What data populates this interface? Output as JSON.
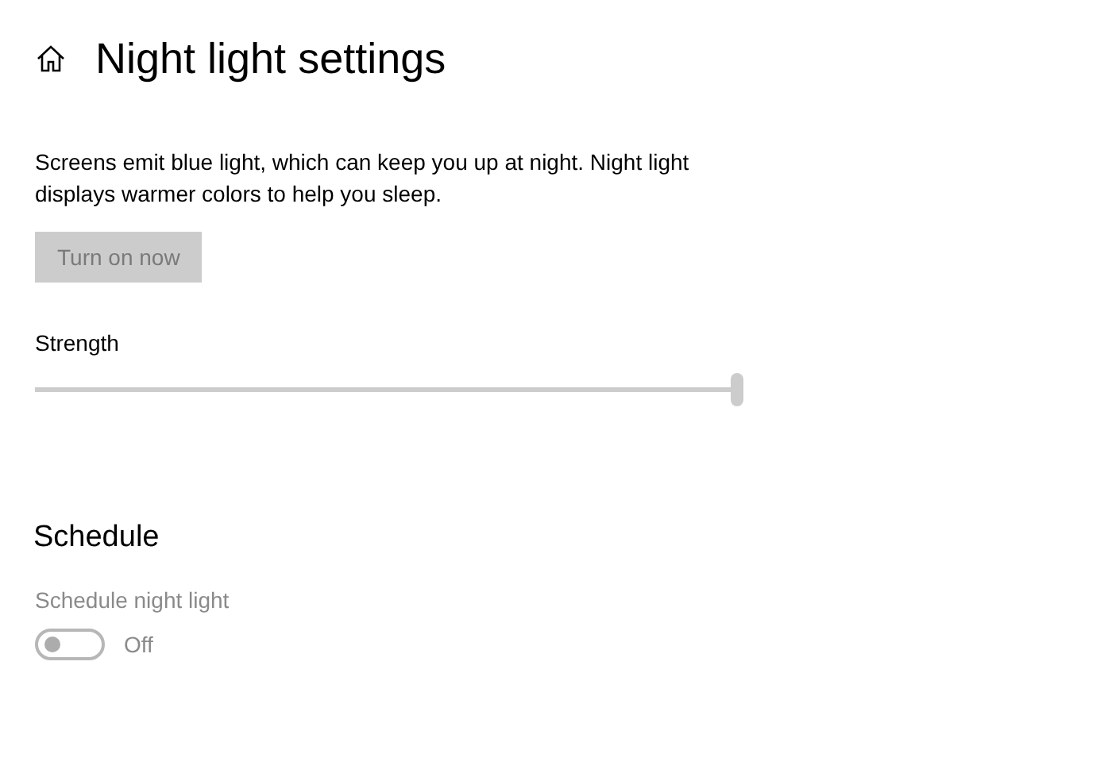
{
  "page": {
    "title": "Night light settings"
  },
  "description": "Screens emit blue light, which can keep you up at night. Night light displays warmer colors to help you sleep.",
  "turn_on_button": {
    "label": "Turn on now",
    "disabled": true
  },
  "strength": {
    "label": "Strength",
    "level": 1.0
  },
  "schedule": {
    "heading": "Schedule",
    "label": "Schedule night light",
    "disabled": true,
    "on": false,
    "state_text": "Off"
  }
}
